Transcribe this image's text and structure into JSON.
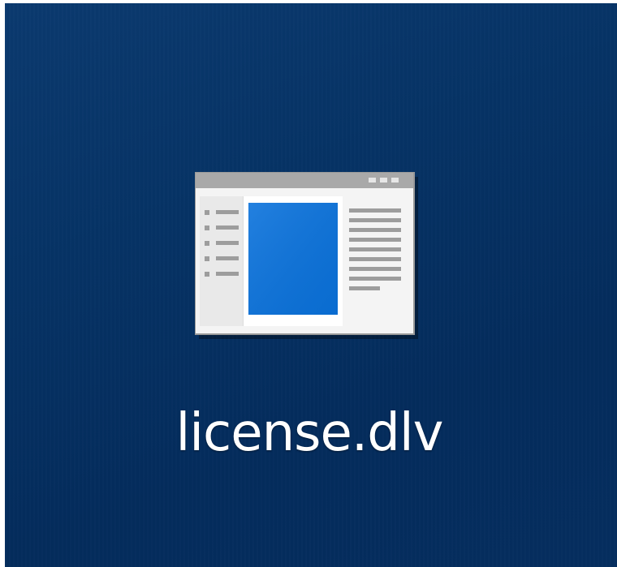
{
  "desktop": {
    "background_color": "#063365",
    "icons": [
      {
        "label": "license.dlv",
        "icon": "document-viewer-window-icon",
        "accent_color": "#0a72dc"
      }
    ]
  }
}
